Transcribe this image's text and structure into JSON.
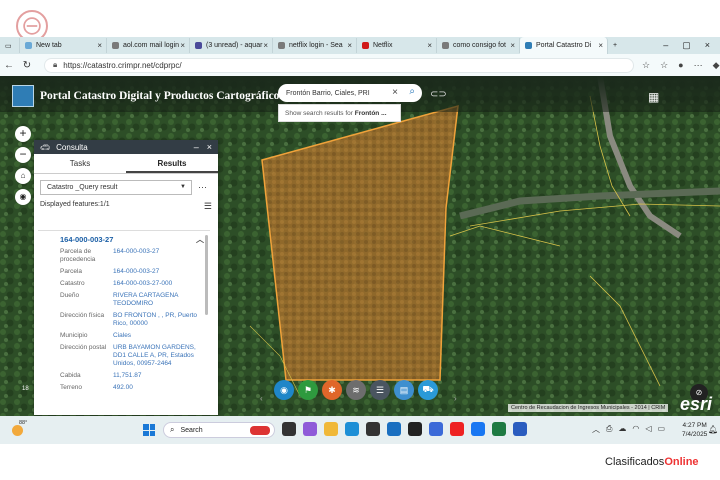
{
  "browser": {
    "tabs": [
      {
        "label": "New tab",
        "color": "#6aa9d6"
      },
      {
        "label": "aol.com mail login",
        "color": "#7a7a7a"
      },
      {
        "label": "(3 unread) - aquar",
        "color": "#4a4a9a"
      },
      {
        "label": "netflix login - Sea",
        "color": "#7a7a7a"
      },
      {
        "label": "Netflix",
        "color": "#d11a1a"
      },
      {
        "label": "como consigo fot",
        "color": "#7a7a7a"
      },
      {
        "label": "Portal Catastro Di",
        "color": "#2f7db5"
      }
    ],
    "url": "https://catastro.crimpr.net/cdprpc/"
  },
  "portal": {
    "title": "Portal Catastro Digital y Productos Cartográficos",
    "search_value": "Frontón Barrio, Ciales, PRI",
    "suggestion_prefix": "Show search results for ",
    "suggestion_term": "Frontón ..."
  },
  "panel": {
    "title": "Consulta",
    "tab_tasks": "Tasks",
    "tab_results": "Results",
    "select_value": "Catastro _Query result",
    "displayed": "Displayed features:1/1",
    "result_id": "164-000-003-27",
    "attributes": [
      {
        "key": "Parcela de procedencia",
        "value": "164-000-003-27"
      },
      {
        "key": "Parcela",
        "value": "164-000-003-27"
      },
      {
        "key": "Catastro",
        "value": "164-000-003-27-000"
      },
      {
        "key": "Dueño",
        "value": "RIVERA CARTAGENA TEODOMIRO"
      },
      {
        "key": "Dirección física",
        "value": "BO FRONTON , , PR, Puerto Rico, 00000"
      },
      {
        "key": "Municipio",
        "value": "Ciales"
      },
      {
        "key": "Dirección postal",
        "value": "URB BAYAMON GARDENS, DD1 CALLE A, PR, Estados Unidos, 00957-2464"
      },
      {
        "key": "Cabida",
        "value": "11,751.87"
      },
      {
        "key": "Terreno",
        "value": "492.00"
      }
    ]
  },
  "map": {
    "attribution": "Centro de Recaudacion de Ingresos Municipales - 2014 | CRIM",
    "esri": "esri",
    "scale_label": "18"
  },
  "taskbar": {
    "temperature": "88°",
    "search_placeholder": "Search",
    "time": "4:27 PM",
    "date": "7/4/2025"
  },
  "site": {
    "brand_main": "Clasificados",
    "brand_accent": "Online"
  }
}
